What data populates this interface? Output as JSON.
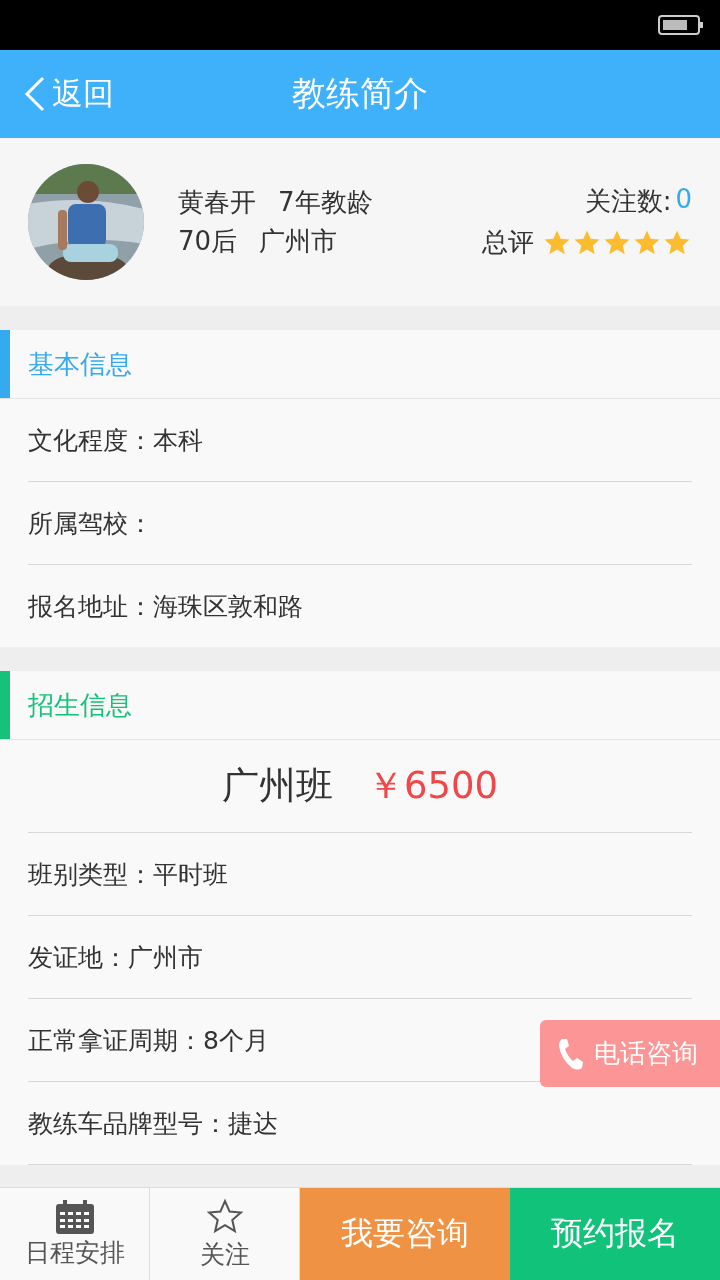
{
  "header": {
    "back": "返回",
    "title": "教练简介"
  },
  "profile": {
    "name": "黄春开",
    "experience": "7年教龄",
    "generation": "70后",
    "city": "广州市",
    "followers_label": "关注数:",
    "followers": "0",
    "rating_label": "总评",
    "stars": 5
  },
  "sections": [
    {
      "title": "基本信息",
      "color": "#35aaf0",
      "items": [
        {
          "kind": "field",
          "text": "文化程度：本科"
        },
        {
          "kind": "field",
          "text": "所属驾校："
        },
        {
          "kind": "field",
          "text": "报名地址：海珠区敦和路"
        }
      ]
    },
    {
      "title": "招生信息",
      "color": "#16c27a",
      "items": [
        {
          "kind": "price",
          "name": "广州班",
          "price": "￥6500"
        },
        {
          "kind": "field",
          "text": "班别类型：平时班"
        },
        {
          "kind": "field",
          "text": "发证地：广州市"
        },
        {
          "kind": "field",
          "text": "正常拿证周期：8个月"
        },
        {
          "kind": "field",
          "text": "教练车品牌型号：捷达"
        }
      ]
    }
  ],
  "phone_button": "电话咨询",
  "bottom_bar": [
    {
      "kind": "calendar",
      "label": "日程安排"
    },
    {
      "kind": "star",
      "label": "关注"
    },
    {
      "kind": "consult",
      "label": "我要咨询"
    },
    {
      "kind": "signup",
      "label": "预约报名"
    }
  ]
}
